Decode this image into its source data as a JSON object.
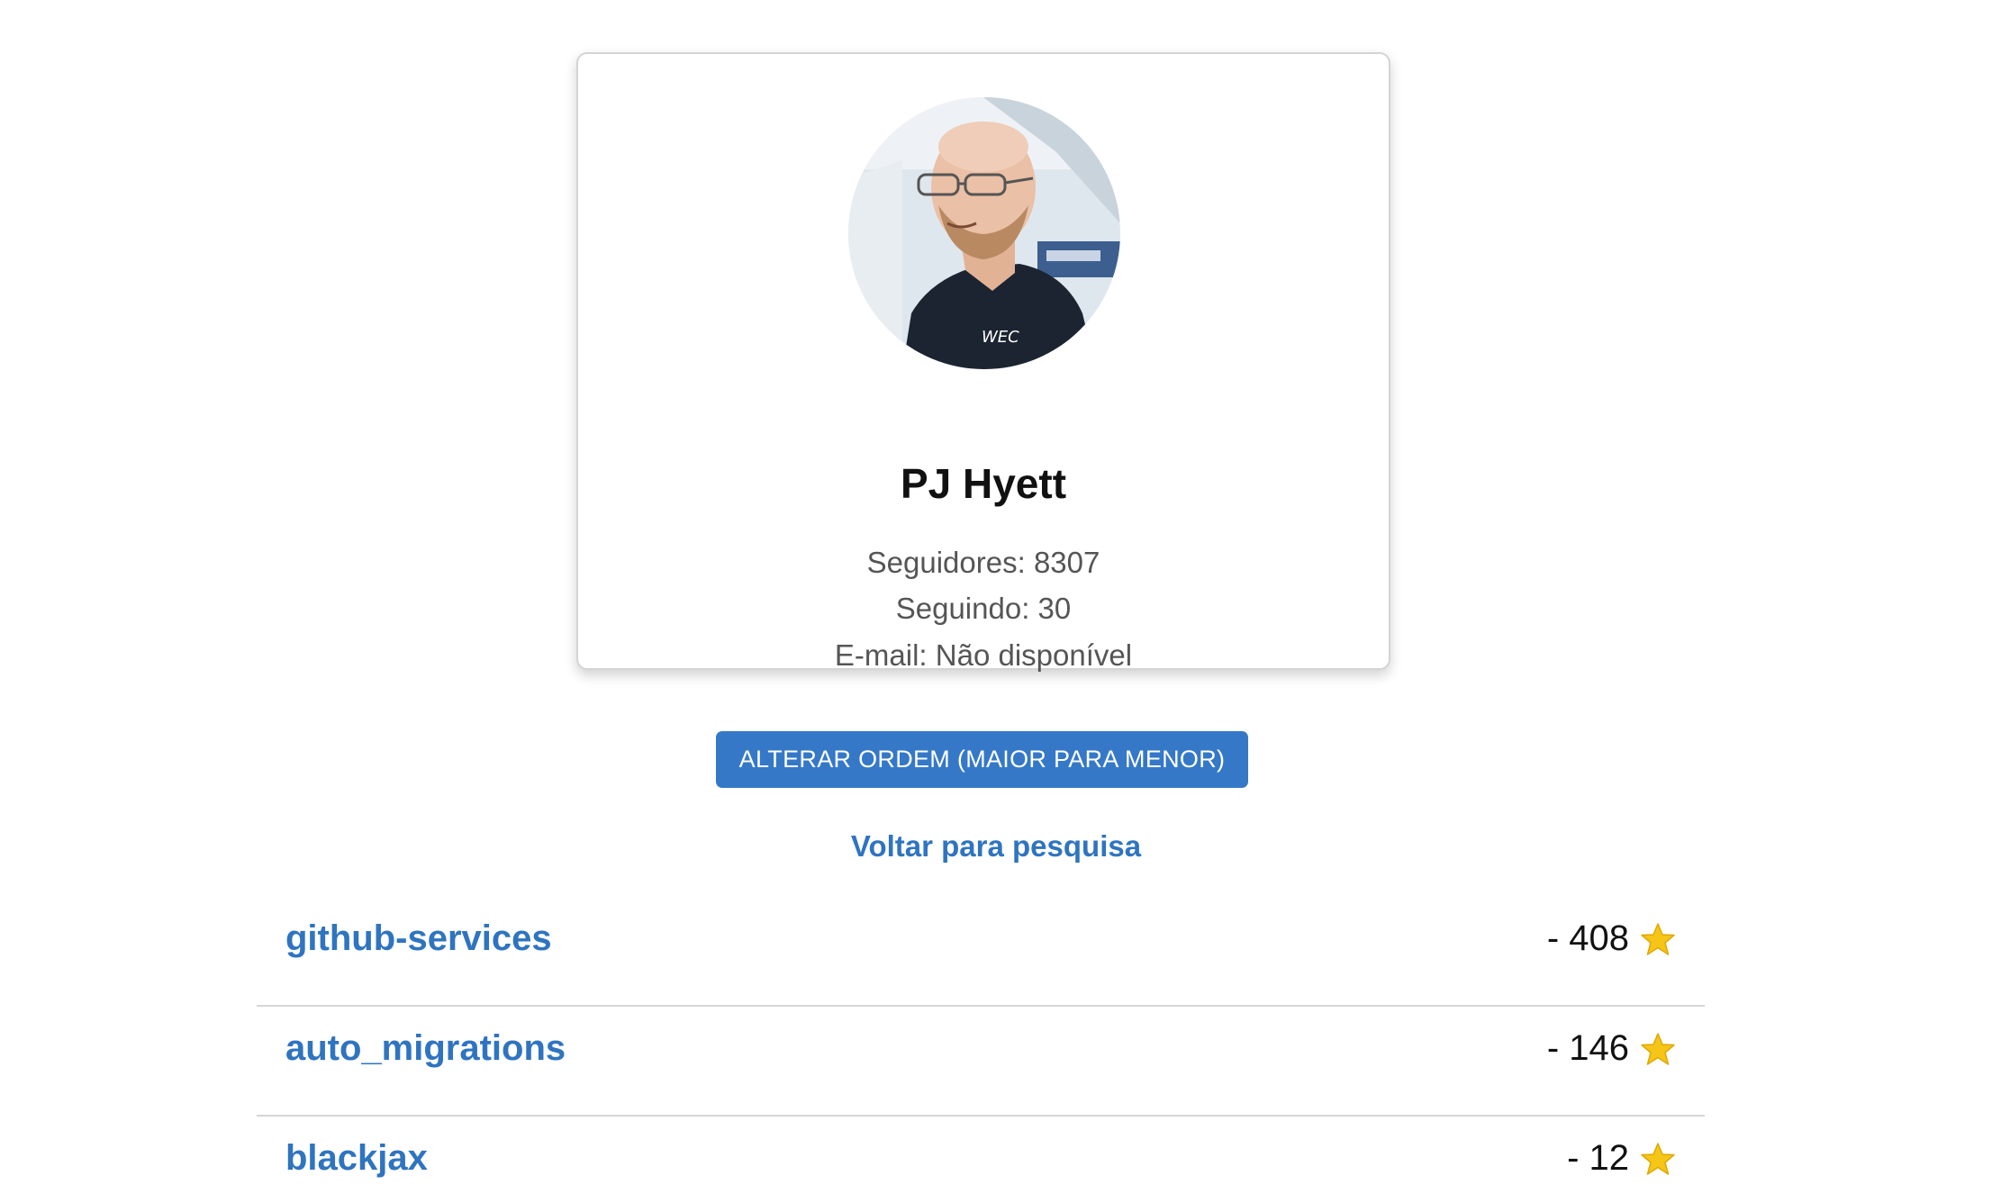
{
  "profile": {
    "name": "PJ Hyett",
    "followers_label": "Seguidores:",
    "followers_value": "8307",
    "following_label": "Seguindo:",
    "following_value": "30",
    "email_label": "E-mail:",
    "email_value": "Não disponível",
    "avatar_icon": "user-photo"
  },
  "actions": {
    "sort_button_label": "ALTERAR ORDEM (MAIOR PARA MENOR)",
    "back_link_label": "Voltar para pesquisa"
  },
  "repositories": [
    {
      "name": "github-services",
      "stars": "- 408"
    },
    {
      "name": "auto_migrations",
      "stars": "- 146"
    },
    {
      "name": "blackjax",
      "stars": "- 12"
    }
  ],
  "colors": {
    "accent": "#3578c8",
    "link": "#2f74c0",
    "star": "#f5c518"
  },
  "icons": {
    "star": "star-icon"
  }
}
